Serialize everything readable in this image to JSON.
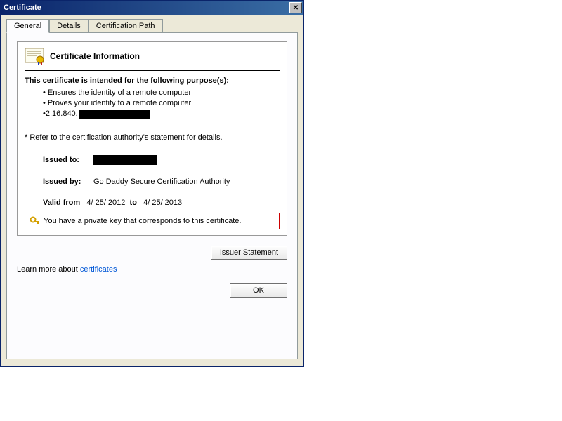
{
  "window": {
    "title": "Certificate",
    "close_label": "✕"
  },
  "tabs": {
    "general": "General",
    "details": "Details",
    "certpath": "Certification Path"
  },
  "cert": {
    "info_title": "Certificate Information",
    "purpose_heading": "This certificate is intended for the following purpose(s):",
    "purposes": [
      "Ensures the identity of a remote computer",
      "Proves your identity to a remote computer"
    ],
    "oid_prefix": "2.16.840.",
    "footnote": "* Refer to the certification authority's statement for details.",
    "issued_to_label": "Issued to:",
    "issued_by_label": "Issued by:",
    "issued_by_value": "Go Daddy Secure Certification Authority",
    "valid_from_label": "Valid from",
    "valid_from_value": "4/ 25/ 2012",
    "valid_to_label": "to",
    "valid_to_value": "4/ 25/ 2013",
    "private_key_msg": "You have a private key that corresponds to this certificate."
  },
  "buttons": {
    "issuer_statement": "Issuer Statement",
    "ok": "OK"
  },
  "learn_more": {
    "prefix": "Learn more about ",
    "link": "certificates"
  }
}
